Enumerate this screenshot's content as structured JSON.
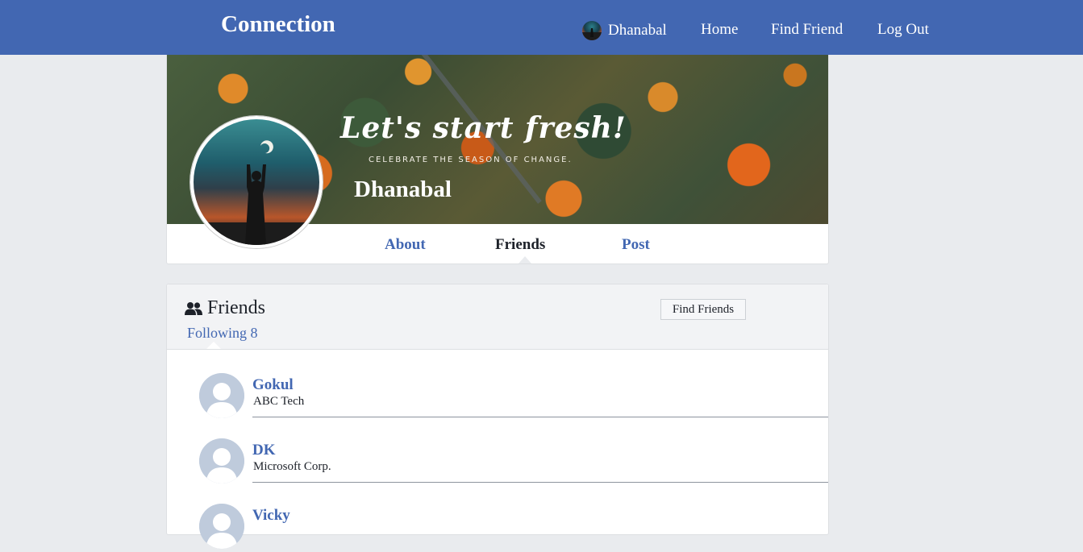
{
  "app": {
    "brand": "Connection"
  },
  "nav": {
    "user_name": "Dhanabal",
    "home": "Home",
    "find_friend": "Find Friend",
    "log_out": "Log Out"
  },
  "cover": {
    "headline": "Let's start fresh!",
    "subtitle": "CELEBRATE THE SEASON OF CHANGE.",
    "profile_name": "Dhanabal"
  },
  "tabs": [
    {
      "label": "About",
      "active": false
    },
    {
      "label": "Friends",
      "active": true
    },
    {
      "label": "Post",
      "active": false
    }
  ],
  "friends": {
    "title": "Friends",
    "following_label": "Following 8",
    "find_button": "Find Friends",
    "list": [
      {
        "name": "Gokul",
        "company": "ABC Tech"
      },
      {
        "name": "DK",
        "company": "Microsoft Corp."
      },
      {
        "name": "Vicky",
        "company": ""
      }
    ]
  },
  "colors": {
    "primary": "#4267b2",
    "background": "#e9ebee",
    "header_bg": "#f2f3f5"
  }
}
